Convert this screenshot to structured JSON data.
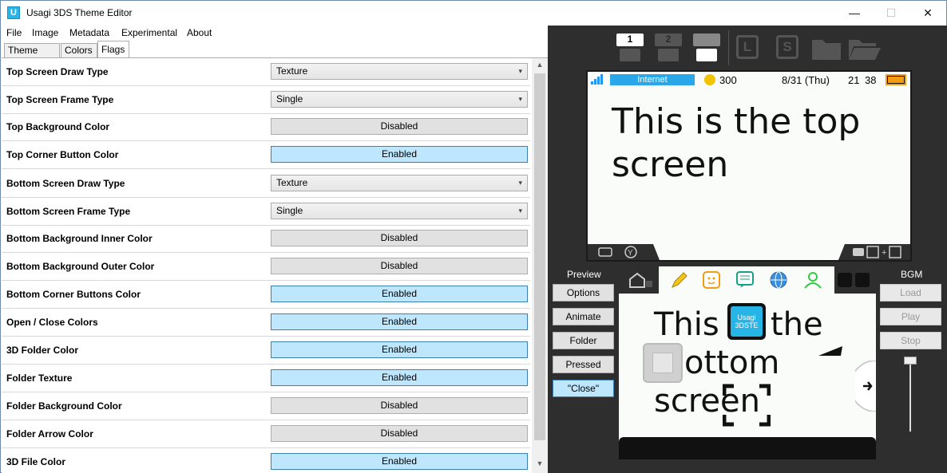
{
  "window": {
    "title": "Usagi 3DS Theme Editor",
    "app_icon_letter": "U",
    "controls": {
      "minimize": "—",
      "maximize": "☐",
      "close": "✕"
    }
  },
  "menu": [
    "File",
    "Image",
    "Metadata",
    "Experimental",
    "About"
  ],
  "tabs": [
    {
      "label": "Theme Info",
      "active": false
    },
    {
      "label": "Colors",
      "active": false
    },
    {
      "label": "Flags",
      "active": true
    }
  ],
  "flags": [
    {
      "label": "Top Screen Draw Type",
      "type": "select",
      "value": "Texture"
    },
    {
      "label": "Top Screen Frame Type",
      "type": "select",
      "value": "Single"
    },
    {
      "label": "Top Background Color",
      "type": "toggle",
      "value": "Disabled"
    },
    {
      "label": "Top Corner Button Color",
      "type": "toggle",
      "value": "Enabled"
    },
    {
      "label": "Bottom Screen Draw Type",
      "type": "select",
      "value": "Texture"
    },
    {
      "label": "Bottom Screen Frame Type",
      "type": "select",
      "value": "Single"
    },
    {
      "label": "Bottom Background Inner Color",
      "type": "toggle",
      "value": "Disabled"
    },
    {
      "label": "Bottom Background Outer Color",
      "type": "toggle",
      "value": "Disabled"
    },
    {
      "label": "Bottom Corner Buttons Color",
      "type": "toggle",
      "value": "Enabled"
    },
    {
      "label": "Open / Close Colors",
      "type": "toggle",
      "value": "Enabled"
    },
    {
      "label": "3D Folder Color",
      "type": "toggle",
      "value": "Enabled"
    },
    {
      "label": "Folder Texture",
      "type": "toggle",
      "value": "Enabled"
    },
    {
      "label": "Folder Background Color",
      "type": "toggle",
      "value": "Disabled"
    },
    {
      "label": "Folder Arrow Color",
      "type": "toggle",
      "value": "Disabled"
    },
    {
      "label": "3D File Color",
      "type": "toggle",
      "value": "Enabled"
    }
  ],
  "toolbar": {
    "screen1": "1",
    "screen2": "2",
    "L": "L",
    "S": "S"
  },
  "top_screen": {
    "wifi": "Internet",
    "coins": "300",
    "date": "8/31 (Thu)",
    "time_h": "21",
    "time_m": "38",
    "text": "This is the top screen"
  },
  "preview": {
    "label": "Preview",
    "buttons": [
      {
        "label": "Options",
        "state": "normal"
      },
      {
        "label": "Animate",
        "state": "normal"
      },
      {
        "label": "Folder",
        "state": "normal"
      },
      {
        "label": "Pressed",
        "state": "normal"
      },
      {
        "label": "\"Close\"",
        "state": "active"
      }
    ]
  },
  "bgm": {
    "label": "BGM",
    "buttons": [
      "Load",
      "Play",
      "Stop"
    ]
  },
  "bottom_screen": {
    "text_line1": "This",
    "text_line1b": "the",
    "text_line2": "ottom",
    "text_line3": "screen",
    "app_icon_line1": "Usagi",
    "app_icon_line2": "3DSTE"
  },
  "colors": {
    "enabled_bg": "#bee6fd",
    "disabled_bg": "#e1e1e1",
    "dark_bg": "#2e2e2e",
    "accent_blue": "#27b4e6"
  }
}
